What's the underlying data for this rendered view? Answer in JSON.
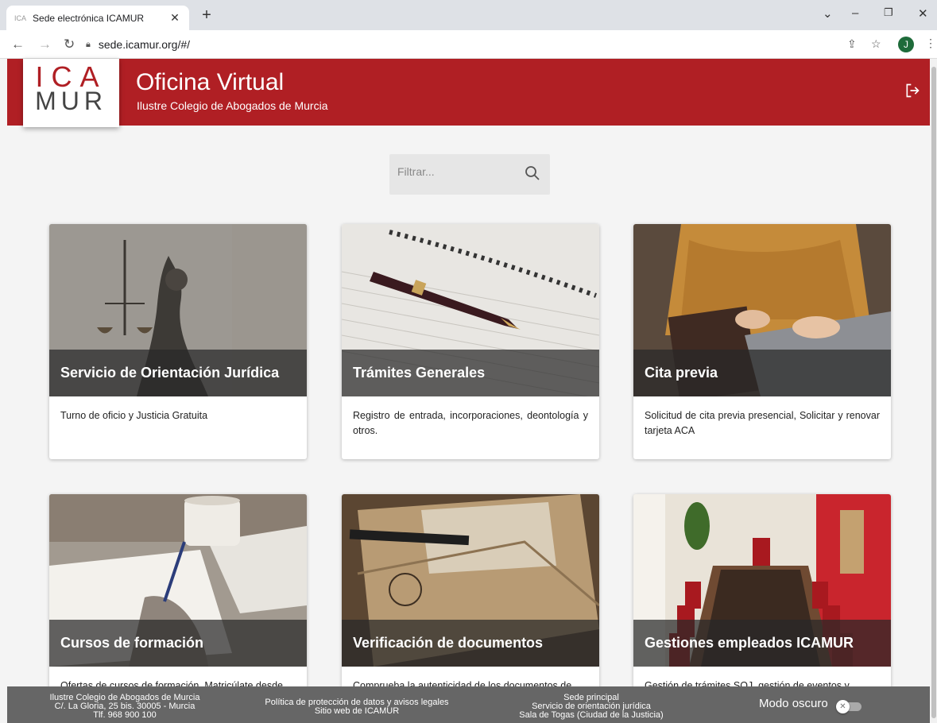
{
  "browser": {
    "tab_title": "Sede electrónica ICAMUR",
    "url": "sede.icamur.org/#/",
    "profile_initial": "J"
  },
  "header": {
    "logo_top": "ICA",
    "logo_bottom": "MUR",
    "title": "Oficina Virtual",
    "subtitle": "Ilustre Colegio de Abogados de Murcia",
    "brand_color": "#b01f24"
  },
  "filter": {
    "placeholder": "Filtrar..."
  },
  "cards": [
    {
      "title": "Servicio de Orientación Jurídica",
      "description": "Turno de oficio y Justicia Gratuita",
      "image": "justice-statue"
    },
    {
      "title": "Trámites Generales",
      "description": "Registro de entrada, incorporaciones, deontología y otros.",
      "image": "pen-notebook"
    },
    {
      "title": "Cita previa",
      "description": "Solicitud de cita previa presencial, Solicitar y renovar tarjeta ACA",
      "image": "laptop-hands"
    },
    {
      "title": "Cursos de formación",
      "description": "Ofertas de cursos de formación. Matricúlate desde",
      "image": "writing-desk"
    },
    {
      "title": "Verificación de documentos",
      "description": "Comprueba la autenticidad de los documentos de",
      "image": "envelope-pen"
    },
    {
      "title": "Gestiones empleados ICAMUR",
      "description": "Gestión de trámites SOJ, gestión de eventos y",
      "image": "meeting-room"
    }
  ],
  "footer": {
    "col1": [
      "Ilustre Colegio de Abogados de Murcia",
      "C/. La Gloria, 25 bis. 30005 - Murcia",
      "Tlf. 968 900 100"
    ],
    "col2": [
      "Política de protección de datos y avisos legales",
      "Sitio web de ICAMUR"
    ],
    "col3": [
      "Sede principal",
      "Servicio de orientación jurídica",
      "Sala de Togas (Ciudad de la Justicia)"
    ],
    "dark_mode_label": "Modo oscuro"
  }
}
